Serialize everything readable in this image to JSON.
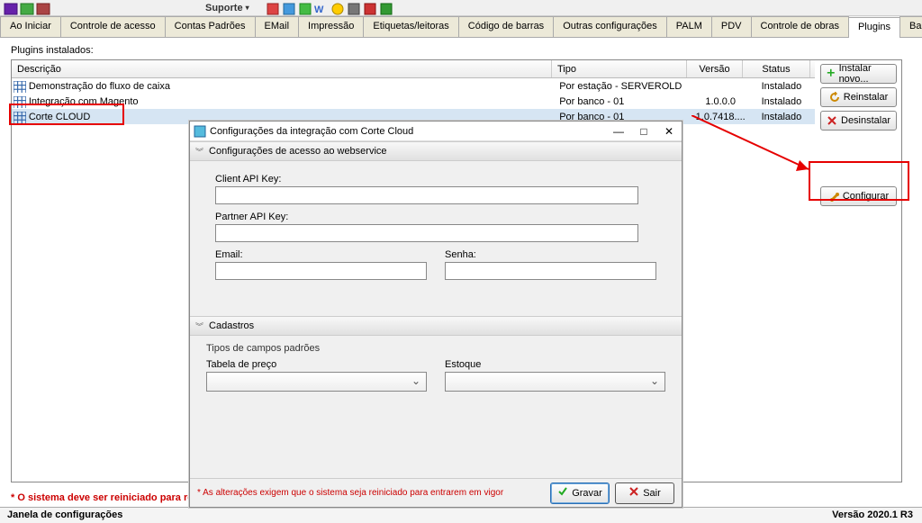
{
  "menu": {
    "suporte": "Suporte"
  },
  "tabs": [
    "Ao Iniciar",
    "Controle de acesso",
    "Contas Padrões",
    "EMail",
    "Impressão",
    "Etiquetas/leitoras",
    "Código de barras",
    "Outras configurações",
    "PALM",
    "PDV",
    "Controle de obras",
    "Plugins",
    "Banc"
  ],
  "active_tab_index": 11,
  "plugins_label": "Plugins instalados:",
  "headers": {
    "desc": "Descrição",
    "tipo": "Tipo",
    "versao": "Versão",
    "status": "Status"
  },
  "rows": [
    {
      "desc": "Demonstração do fluxo de caixa",
      "tipo": "Por estação - SERVEROLD",
      "versao": "",
      "status": "Instalado"
    },
    {
      "desc": "Integração com Magento",
      "tipo": "Por banco - 01",
      "versao": "1.0.0.0",
      "status": "Instalado"
    },
    {
      "desc": "Corte CLOUD",
      "tipo": "Por banco - 01",
      "versao": "1.0.7418....",
      "status": "Instalado"
    }
  ],
  "selected_row_index": 2,
  "buttons": {
    "instalar": "Instalar novo...",
    "reinstalar": "Reinstalar",
    "desinstalar": "Desinstalar",
    "configurar": "Configurar"
  },
  "restart_note": "* O sistema deve ser reiniciado para re",
  "status_left": "Janela de configurações",
  "status_right": "Versão 2020.1 R3",
  "dialog": {
    "title": "Configurações da integração com Corte Cloud",
    "section1": "Configurações de acesso ao webservice",
    "client_key_label": "Client API Key:",
    "partner_key_label": "Partner API Key:",
    "email_label": "Email:",
    "senha_label": "Senha:",
    "section2": "Cadastros",
    "tipos_label": "Tipos de campos padrões",
    "tabela_label": "Tabela de preço",
    "estoque_label": "Estoque",
    "note": "* As alterações exigem que o sistema seja reiniciado para entrarem em vigor",
    "gravar": "Gravar",
    "sair": "Sair"
  }
}
